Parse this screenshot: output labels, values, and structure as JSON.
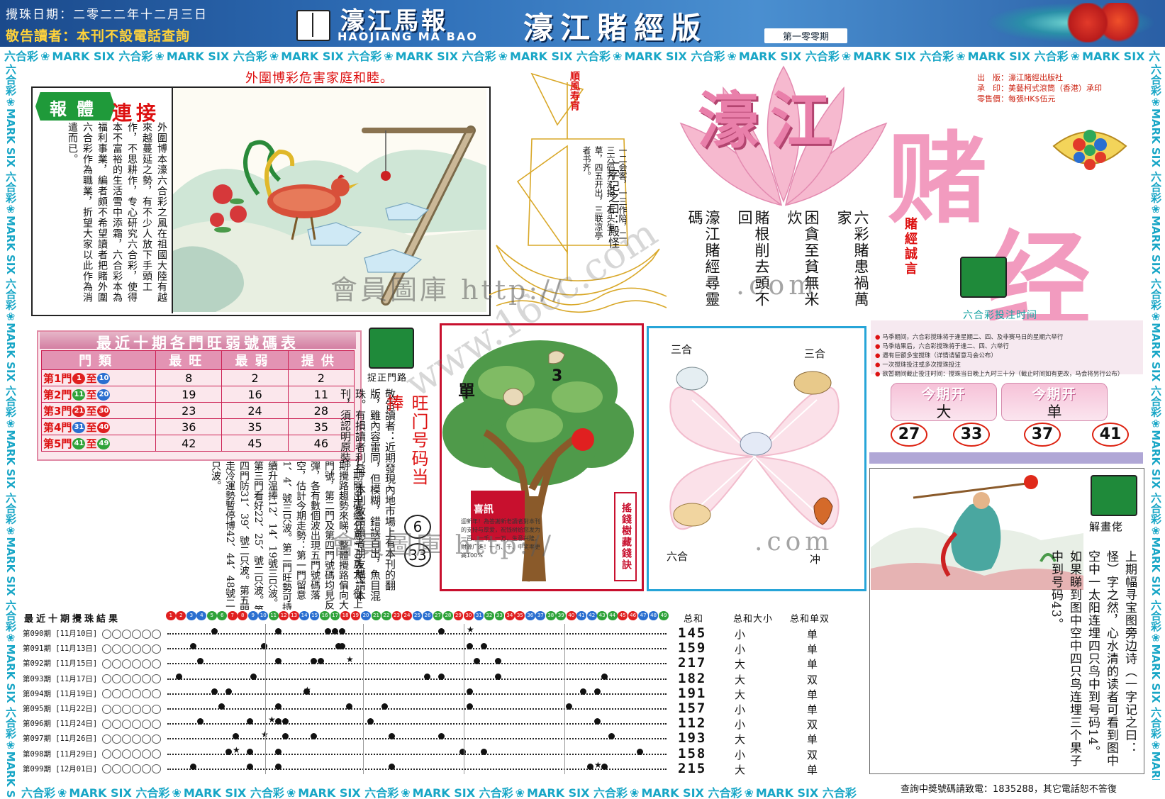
{
  "header": {
    "date": "攪珠日期：二零二二年十二月三日",
    "notice": "敬告讀者：本刊不設電話查詢",
    "masthead": "濠江馬報",
    "masthead_en": "HAOJIANG MA BAO",
    "edition": "濠江賭經版",
    "issue": "第一零零期"
  },
  "marksix": {
    "zh": "六合彩",
    "en": "MARK SIX"
  },
  "section1": {
    "heading": "外圍博彩危害家庭和睦。",
    "ribbon": "報體",
    "title": "連接",
    "text": "外圍博本濠六合彩之風在祖國大陸有越來越蔓延之勢，有不少人放下手頭工作，不思耕作，专心研究六合彩，使得本不富裕的生活雪中添霜，六合彩本為福利事業，編者頗不希望讀者把賭外圍六合彩作為職業，折望大家以此作為消遣而已。"
  },
  "boat": {
    "flag": "順風寿宵",
    "poem": "一二会客，一三作陪，二三六码齐汇报，石头生草，四五开出，三联凉亭者书齐。",
    "title": "一字记之曰：殿怪"
  },
  "masthead_right": {
    "big1": "濠江",
    "big2": "赌",
    "big3": "经",
    "publisher_label": "出　版：",
    "publisher": "濠江賭經出版社",
    "printer_label": "承　印：",
    "printer": "美藝柯式滾筒（香港）承印",
    "price_label": "零售價：",
    "price": "每張HK$伍元"
  },
  "maxims": {
    "title": "賭經誠言",
    "lines": [
      "六彩賭患禍萬家",
      "困貪至貧無米炊",
      "賭根削去頭不回",
      "濠江賭經尋靈碼"
    ]
  },
  "draw_time": {
    "title": "六合彩投注时间",
    "notes": [
      "马季期间，六合彩搅珠将于逢星期二、四、及非赛马日的星期六举行",
      "马季结果后，六合彩搅珠将于逢二、四、六举行",
      "遇有巨额多宝搅珠（详情请留意马会公布）",
      "一次搅珠投注或多次搅珠投注",
      "欲暂期间截止投注时间：搅珠当日晚上九时三十分（截止时间如有更改，马会将另行公布）"
    ],
    "open_label": "今期开",
    "open_values": [
      "大",
      "单"
    ],
    "balls": [
      "27",
      "33",
      "37",
      "41"
    ]
  },
  "ten_period": {
    "title": "最近十期各門旺弱號碼表",
    "headers": [
      "門類",
      "最旺",
      "最弱",
      "提供"
    ],
    "rows": [
      {
        "gate": "第1門",
        "from": "1",
        "to": "10",
        "hot": "8",
        "cold": "2",
        "pick": "2"
      },
      {
        "gate": "第2門",
        "from": "11",
        "to": "20",
        "hot": "19",
        "cold": "16",
        "pick": "11"
      },
      {
        "gate": "第3門",
        "from": "21",
        "to": "30",
        "hot": "23",
        "cold": "24",
        "pick": "28"
      },
      {
        "gate": "第4門",
        "from": "31",
        "to": "40",
        "hot": "36",
        "cold": "35",
        "pick": "35"
      },
      {
        "gate": "第5門",
        "from": "41",
        "to": "49",
        "hot": "42",
        "cold": "45",
        "pick": "46"
      }
    ],
    "connector": "至"
  },
  "tip": {
    "label": "捉正門路",
    "notice": "敬告讀者：近期發現內地市場上有本刊的翻版，雖內容雷同，但模糊，錯誤百出，魚目混珠。有損讀者利益，本刊敬請讀者朋友購請本刊，須認明原裝。",
    "hot_title": "旺门号码当捧",
    "hot_balls": [
      "6",
      "33"
    ],
    "body": "上期開出碼總分爲170爲大，從上期攪路趨勢來睇，整體攪路偏向大門號，第二門及第四門號碼均見反彈，各有數個波出現五門號碼落空，估計今期走勢：第一門留意1、4、號三只波。第二門旺勢可持續升温捧12、14、19號三只波。第三門看好22、25、號二只波。第四門防31、39、號二只波。第五門走冷運勢暫停博42、44、48號二只波。"
  },
  "tree": {
    "dan": "單",
    "num": "3",
    "banner": "喜訊",
    "msg": "迎新年！為答謝新老讀者對本刊的支持与厚爱，祝钱树给您发为一百、一千、一万，生意兴隆，財源广進！一百、千、中奖率更高100%",
    "label": "搖錢樹藏錢訣"
  },
  "zodiac": {
    "top_left": "三合",
    "top_right": "三合",
    "bottom_left": "六合",
    "bottom_right": "冲"
  },
  "results": {
    "title": "最近十期攪珠結果",
    "col_total": "总和",
    "col_size": "总和大小",
    "col_oe": "总和单双",
    "rows": [
      {
        "label": "第090期 [11月10日]",
        "total": "145",
        "size": "小",
        "oe": "单"
      },
      {
        "label": "第091期 [11月13日]",
        "total": "159",
        "size": "小",
        "oe": "单"
      },
      {
        "label": "第092期 [11月15日]",
        "total": "217",
        "size": "大",
        "oe": "单"
      },
      {
        "label": "第093期 [11月17日]",
        "total": "182",
        "size": "大",
        "oe": "双"
      },
      {
        "label": "第094期 [11月19日]",
        "total": "191",
        "size": "大",
        "oe": "单"
      },
      {
        "label": "第095期 [11月22日]",
        "total": "157",
        "size": "小",
        "oe": "单"
      },
      {
        "label": "第096期 [11月24日]",
        "total": "112",
        "size": "小",
        "oe": "双"
      },
      {
        "label": "第097期 [11月26日]",
        "total": "193",
        "size": "大",
        "oe": "单"
      },
      {
        "label": "第098期 [11月29日]",
        "total": "158",
        "size": "小",
        "oe": "双"
      },
      {
        "label": "第099期 [12月01日]",
        "total": "215",
        "size": "大",
        "oe": "单"
      }
    ]
  },
  "riddle": {
    "label": "解畫佬",
    "text": "上期幅寻宝图旁边诗（一字记之曰：怪）字之然，心水清的读者可看到图中空中一太阳连埋四只鸟中到号码14。如果睇到图中空中四只鸟连埋三个果子中到号码43。"
  },
  "footer": {
    "contact": "查詢中獎號碼請致電：1835288，其它電話恕不答復"
  },
  "watermark": {
    "text1": "會員圖庫 http://",
    "text2": ".com",
    "text3": "會員圖庫 http://",
    "text4": ".com",
    "diag": "www.16cc.com"
  },
  "colors": {
    "header_blue": "#2f6fb8",
    "marksix_cyan": "#18a6c6",
    "accent_red": "#d11",
    "pink": "#f29bbf"
  }
}
